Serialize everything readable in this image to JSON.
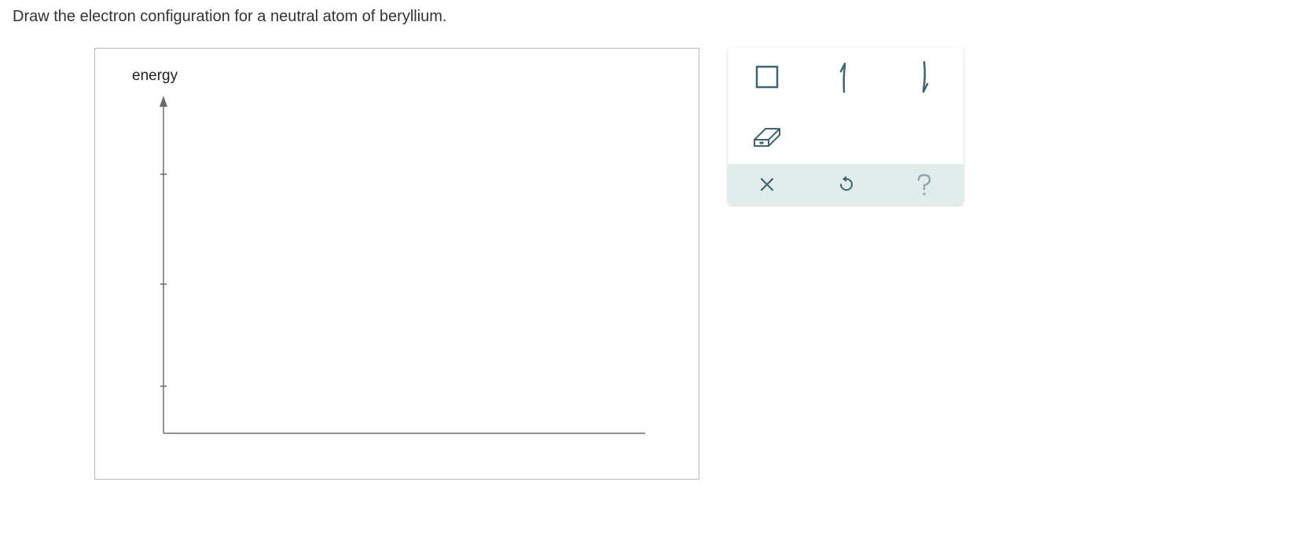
{
  "prompt": "Draw the electron configuration for a neutral atom of beryllium.",
  "canvas": {
    "energy_label": "energy"
  },
  "palette": {
    "tools": {
      "orbital_box": "orbital-box",
      "spin_up": "spin-up-arrow",
      "spin_down": "spin-down-arrow",
      "eraser": "eraser"
    },
    "actions": {
      "clear": "clear",
      "undo": "undo",
      "help": "help"
    }
  }
}
